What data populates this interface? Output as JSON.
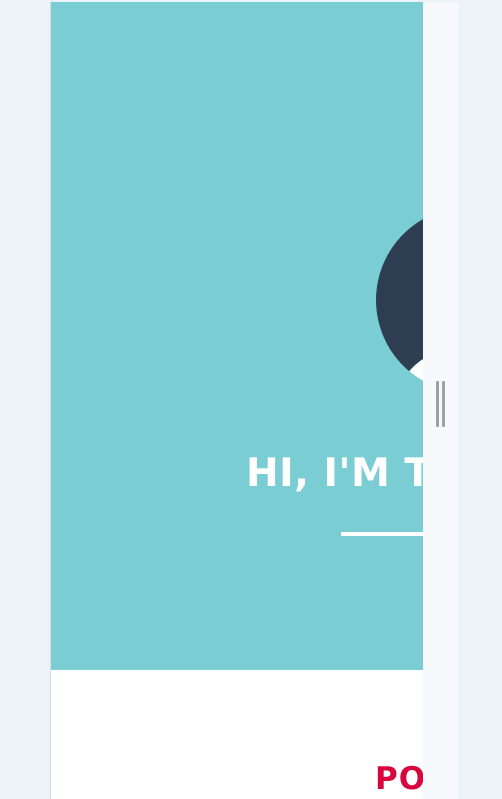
{
  "hero": {
    "title": "HI, I'M TI",
    "background_color": "#7acdd2",
    "avatar_color": "#2e3e52"
  },
  "section": {
    "heading": "PO",
    "heading_color": "#d8063f"
  },
  "viewport": {
    "resize_handle_icon": "vertical-grip-icon"
  }
}
